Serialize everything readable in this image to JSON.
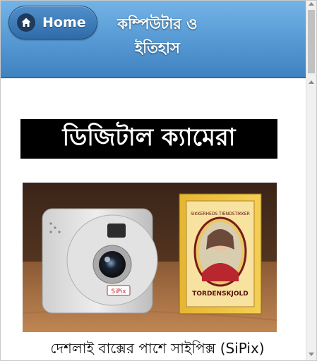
{
  "header": {
    "home_label": "Home",
    "title_line1": "কম্পিউটার ও",
    "title_line2": "ইতিহাস"
  },
  "article": {
    "heading": "ডিজিটাল ক্যামেরা",
    "image": {
      "camera_brand": "SiPix",
      "box_text_top": "SIKKERHEDS TÆNDSTIKKER",
      "box_text_bottom": "TORDENSKJOLD"
    },
    "caption": "দেশলাই বাক্সের পাশে সাইপিক্স (SiPix)"
  },
  "colors": {
    "header_gradient_top": "#74b3e6",
    "header_gradient_bottom": "#3f82c0",
    "heading_background": "#000000",
    "heading_text": "#ffffff"
  }
}
